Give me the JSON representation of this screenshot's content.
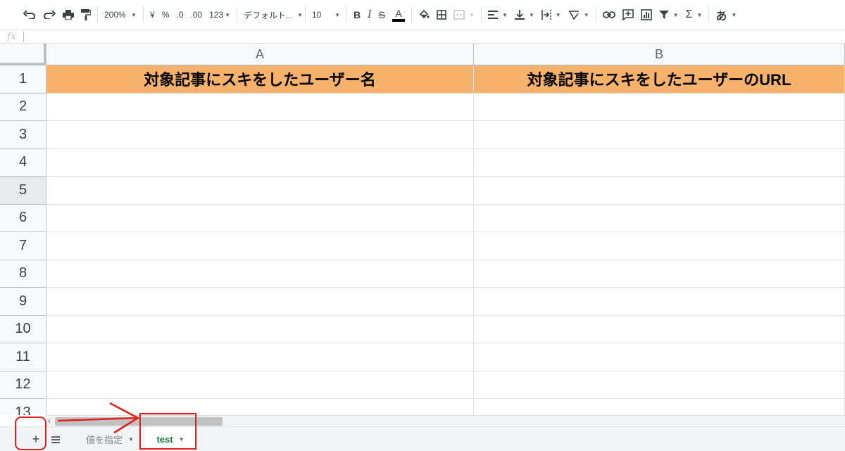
{
  "toolbar": {
    "zoom": "200%",
    "currency": "¥",
    "percent": "%",
    "decrease_decimals": ".0",
    "increase_decimals": ".00",
    "more_formats": "123",
    "font_name": "デフォルト...",
    "font_size": "10",
    "bold": "B",
    "italic": "I",
    "strikethrough": "S",
    "text_color": "A",
    "sum_symbol": "Σ",
    "input_tools": "あ"
  },
  "formula_bar": {
    "label": "fx",
    "value": ""
  },
  "columns": [
    {
      "letter": "A"
    },
    {
      "letter": "B"
    }
  ],
  "rows": [
    "1",
    "2",
    "3",
    "4",
    "5",
    "6",
    "7",
    "8",
    "9",
    "10",
    "11",
    "12",
    "13"
  ],
  "cells": {
    "A1": "対象記事にスキをしたユーザー名",
    "B1": "対象記事にスキをしたユーザーのURL"
  },
  "sheet_tabs": {
    "add_sheet": "+",
    "tabs": [
      {
        "label": "値を指定",
        "active": false
      },
      {
        "label": "test",
        "active": true
      }
    ]
  },
  "colors": {
    "header_fill": "#f6b26b",
    "annotation_red": "#e0201a",
    "active_tab_text": "#188038"
  }
}
